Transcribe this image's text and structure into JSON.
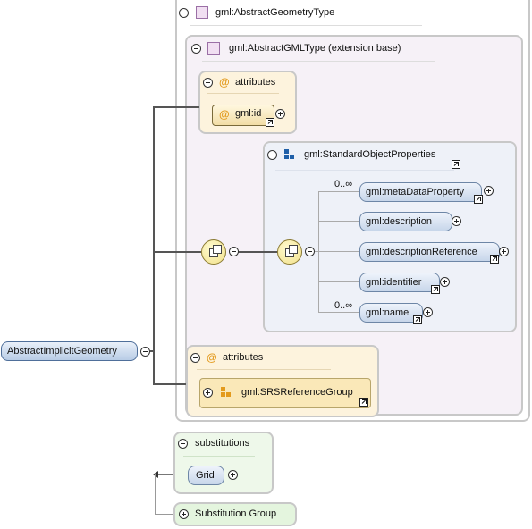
{
  "root_element": "AbstractImplicitGeometry",
  "type_outer": {
    "label": "gml:AbstractGeometryType"
  },
  "type_inner": {
    "label": "gml:AbstractGMLType (extension base)"
  },
  "attributes_top": {
    "label": "attributes",
    "item": "gml:id"
  },
  "sequence": {
    "group_label": "gml:StandardObjectProperties",
    "items": [
      {
        "name": "gml:metaDataProperty",
        "cardinality": "0..∞"
      },
      {
        "name": "gml:description",
        "cardinality": ""
      },
      {
        "name": "gml:descriptionReference",
        "cardinality": ""
      },
      {
        "name": "gml:identifier",
        "cardinality": ""
      },
      {
        "name": "gml:name",
        "cardinality": "0..∞"
      }
    ]
  },
  "attributes_bottom": {
    "label": "attributes",
    "item": "gml:SRSReferenceGroup"
  },
  "substitutions": {
    "label": "substitutions",
    "item": "Grid"
  },
  "substitution_group": {
    "label": "Substitution Group"
  }
}
